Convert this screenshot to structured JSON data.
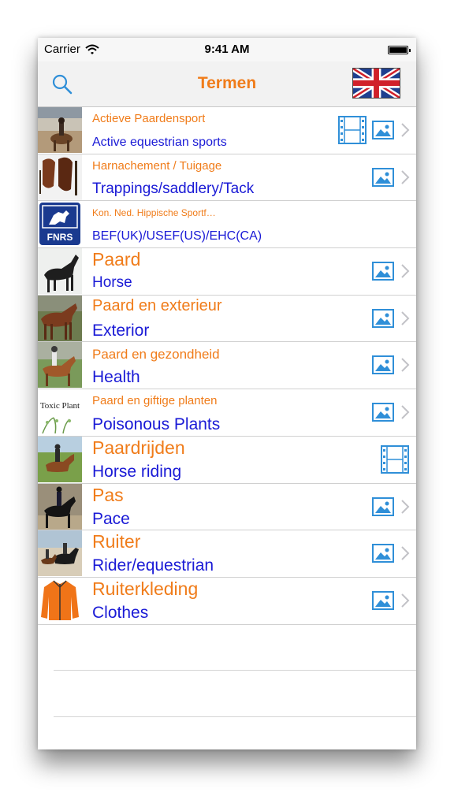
{
  "status_bar": {
    "carrier": "Carrier",
    "time": "9:41 AM"
  },
  "nav": {
    "title": "Termen",
    "search_icon": "search-icon",
    "flag_icon": "uk-flag-icon"
  },
  "rows": [
    {
      "nl": "Actieve Paardensport",
      "en": "Active equestrian sports",
      "film": true,
      "photo": true,
      "chevron": true,
      "thumb": "horse-rider-beach"
    },
    {
      "nl": "Harnachement / Tuigage",
      "en": "Trappings/saddlery/Tack",
      "film": false,
      "photo": true,
      "chevron": true,
      "thumb": "saddles"
    },
    {
      "nl": "Kon. Ned. Hippische Sportf…",
      "en": "BEF(UK)/USEF(US)/EHC(CA)",
      "film": false,
      "photo": false,
      "chevron": false,
      "thumb": "fnrs-logo",
      "logo_text": "FNRS"
    },
    {
      "nl": "Paard",
      "en": "Horse",
      "film": false,
      "photo": true,
      "chevron": true,
      "thumb": "black-horse"
    },
    {
      "nl": "Paard en exterieur",
      "en": "Exterior",
      "film": false,
      "photo": true,
      "chevron": true,
      "thumb": "brown-horse"
    },
    {
      "nl": "Paard en gezondheid",
      "en": "Health",
      "film": false,
      "photo": true,
      "chevron": true,
      "thumb": "rider-chestnut"
    },
    {
      "nl": "Paard en giftige planten",
      "en": "Poisonous Plants",
      "film": false,
      "photo": true,
      "chevron": true,
      "thumb": "toxic-plant",
      "thumb_text": "Toxic Plant"
    },
    {
      "nl": "Paardrijden",
      "en": "Horse riding",
      "film": true,
      "photo": false,
      "chevron": false,
      "thumb": "riding-field"
    },
    {
      "nl": "Pas",
      "en": "Pace",
      "film": false,
      "photo": true,
      "chevron": true,
      "thumb": "dressage"
    },
    {
      "nl": "Ruiter",
      "en": "Rider/equestrian",
      "film": false,
      "photo": true,
      "chevron": true,
      "thumb": "riders-beach"
    },
    {
      "nl": "Ruiterkleding",
      "en": "Clothes",
      "film": false,
      "photo": true,
      "chevron": true,
      "thumb": "orange-jacket"
    }
  ],
  "colors": {
    "dutch_text": "#f07c1a",
    "english_text": "#1a1ad6",
    "icon_blue": "#2f8fd8"
  }
}
